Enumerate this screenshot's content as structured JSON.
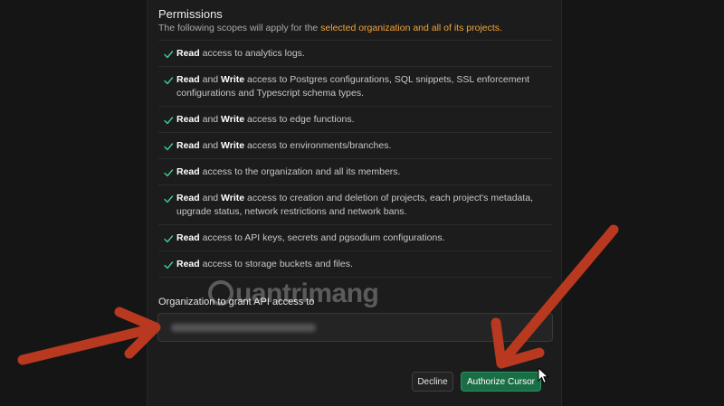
{
  "permissions": {
    "title": "Permissions",
    "desc_prefix": "The following scopes will apply for the ",
    "desc_highlight": "selected organization and all of its projects."
  },
  "scopes": [
    {
      "read": "Read",
      "and": "",
      "write": "",
      "rest": " access to analytics logs."
    },
    {
      "read": "Read",
      "and": " and ",
      "write": "Write",
      "rest": " access to Postgres configurations, SQL snippets, SSL enforcement configurations and Typescript schema types."
    },
    {
      "read": "Read",
      "and": " and ",
      "write": "Write",
      "rest": " access to edge functions."
    },
    {
      "read": "Read",
      "and": " and ",
      "write": "Write",
      "rest": " access to environments/branches."
    },
    {
      "read": "Read",
      "and": "",
      "write": "",
      "rest": " access to the organization and all its members."
    },
    {
      "read": "Read",
      "and": " and ",
      "write": "Write",
      "rest": " access to creation and deletion of projects, each project's metadata, upgrade status, network restrictions and network bans."
    },
    {
      "read": "Read",
      "and": "",
      "write": "",
      "rest": " access to API keys, secrets and pgsodium configurations."
    },
    {
      "read": "Read",
      "and": "",
      "write": "",
      "rest": " access to storage buckets and files."
    }
  ],
  "organization": {
    "label": "Organization to grant API access to",
    "selected_value": ""
  },
  "actions": {
    "decline_label": "Decline",
    "authorize_label": "Authorize Cursor"
  },
  "watermark": {
    "text": "uantrimang"
  },
  "colors": {
    "highlight": "#f3a338",
    "check": "#3ecf8e",
    "authorize_bg": "#1a6e45",
    "arrow": "#b8391f"
  },
  "icons": {
    "check": "check-icon",
    "cursor": "mouse-pointer-icon",
    "arrow": "annotation-arrow"
  }
}
